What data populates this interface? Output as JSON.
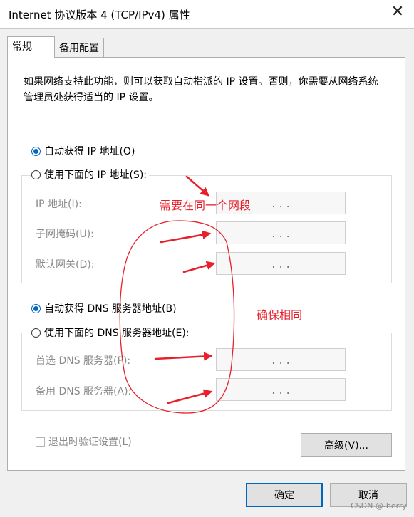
{
  "window": {
    "title": "Internet 协议版本 4 (TCP/IPv4) 属性"
  },
  "tabs": [
    {
      "label": "常规"
    },
    {
      "label": "备用配置"
    }
  ],
  "description": "如果网络支持此功能，则可以获取自动指派的 IP 设置。否则，你需要从网络系统管理员处获得适当的 IP 设置。",
  "ip_section": {
    "auto_label": "自动获得 IP 地址(O)",
    "manual_label": "使用下面的 IP 地址(S):",
    "selected": "auto",
    "fields": [
      {
        "label": "IP 地址(I):",
        "value": " .  .  . "
      },
      {
        "label": "子网掩码(U):",
        "value": " .  .  . "
      },
      {
        "label": "默认网关(D):",
        "value": " .  .  . "
      }
    ]
  },
  "dns_section": {
    "auto_label": "自动获得 DNS 服务器地址(B)",
    "manual_label": "使用下面的 DNS 服务器地址(E):",
    "selected": "auto",
    "fields": [
      {
        "label": "首选 DNS 服务器(P):",
        "value": " .  .  . "
      },
      {
        "label": "备用 DNS 服务器(A):",
        "value": " .  .  . "
      }
    ]
  },
  "validate_label": "退出时验证设置(L)",
  "advanced_button": "高级(V)...",
  "ok_button": "确定",
  "cancel_button": "取消",
  "annotations": {
    "same_segment": "需要在同一个网段",
    "ensure_same": "确保相同",
    "color": "#e8202b"
  },
  "watermark": "CSDN @-berry",
  "icons": {
    "close": "close-icon"
  },
  "colors": {
    "accent": "#0067c0"
  }
}
